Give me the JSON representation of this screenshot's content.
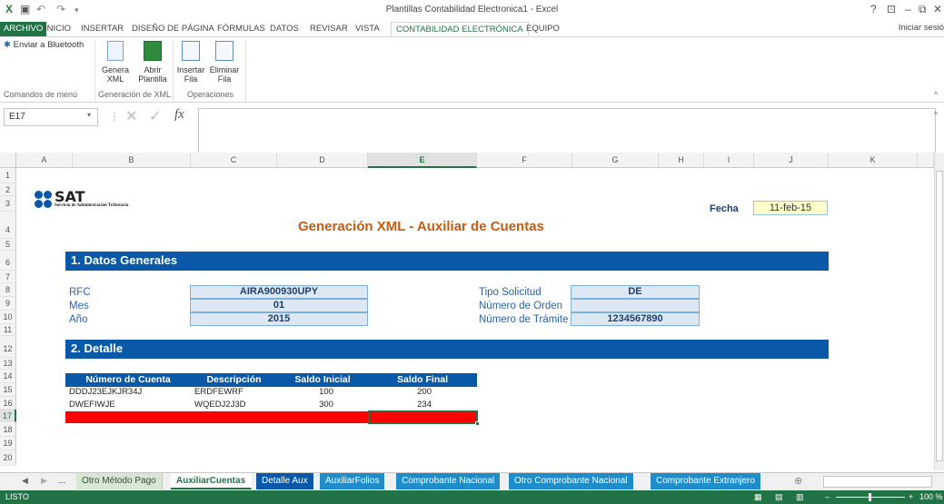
{
  "window": {
    "title": "Plantillas Contabilidad Electronica1 - Excel",
    "help": "?",
    "controls": [
      "–",
      "⧉",
      "✕"
    ]
  },
  "ribbon": {
    "tabs": [
      "ARCHIVO",
      "INICIO",
      "INSERTAR",
      "DISEÑO DE PÁGINA",
      "FÓRMULAS",
      "DATOS",
      "REVISAR",
      "VISTA",
      "CONTABILIDAD ELECTRÓNICA",
      "EQUIPO"
    ],
    "active_tab": "CONTABILIDAD ELECTRÓNICA",
    "signin": "Iniciar sesió",
    "bluetooth": "Enviar a Bluetooth",
    "buttons": {
      "genera": [
        "Genera",
        "XML"
      ],
      "abrir": [
        "Abrir",
        "Plantilla"
      ],
      "insertar": [
        "Insertar",
        "Fila"
      ],
      "eliminar": [
        "Eliminar",
        "Fila"
      ]
    },
    "groups": [
      "Comandos de menú",
      "Generación de XML",
      "Operaciones"
    ]
  },
  "formula_bar": {
    "namebox": "E17",
    "fx": "fx",
    "value": ""
  },
  "columns": [
    "A",
    "B",
    "C",
    "D",
    "E",
    "F",
    "G",
    "H",
    "I",
    "J",
    "K"
  ],
  "rows": [
    "1",
    "2",
    "3",
    "4",
    "5",
    "6",
    "7",
    "8",
    "9",
    "10",
    "11",
    "12",
    "13",
    "14",
    "15",
    "16",
    "17",
    "18",
    "19",
    "20"
  ],
  "sheet": {
    "logo_text": "SAT",
    "logo_sub": "Servicio de Administración Tributaria",
    "title": "Generación XML - Auxiliar de Cuentas",
    "fecha_label": "Fecha",
    "fecha_value": "11-feb-15",
    "section1": "1. Datos Generales",
    "section2": "2. Detalle",
    "rfc_label": "RFC",
    "rfc_value": "AIRA900930UPY",
    "mes_label": "Mes",
    "mes_value": "01",
    "anio_label": "Año",
    "anio_value": "2015",
    "tipo_label": "Tipo Solicitud",
    "tipo_value": "DE",
    "orden_label": "Número de Orden",
    "orden_value": "",
    "tramite_label": "Número de Trámite",
    "tramite_value": "1234567890",
    "table": {
      "headers": [
        "Número de Cuenta",
        "Descripción",
        "Saldo Inicial",
        "Saldo Final"
      ],
      "rows": [
        [
          "DDDJ23EJKJR34J",
          "ERDFEWRF",
          "100",
          "200"
        ],
        [
          "DWEFIWJE",
          "WQEDJ2J3D",
          "300",
          "234"
        ]
      ]
    }
  },
  "sheet_tabs": [
    "...",
    "Otro Método Pago",
    "AuxiliarCuentas",
    "Detalle Aux",
    "AuxiliarFolios",
    "Comprobante Nacional",
    "Otro Comprobante Nacional",
    "Comprobante Extranjero"
  ],
  "active_sheet": "AuxiliarCuentas",
  "status": {
    "left": "LISTO",
    "zoom": "100 %"
  },
  "colors": {
    "accent": "#217346",
    "blue": "#0a58a8",
    "highlight_red": "#ff0000"
  }
}
